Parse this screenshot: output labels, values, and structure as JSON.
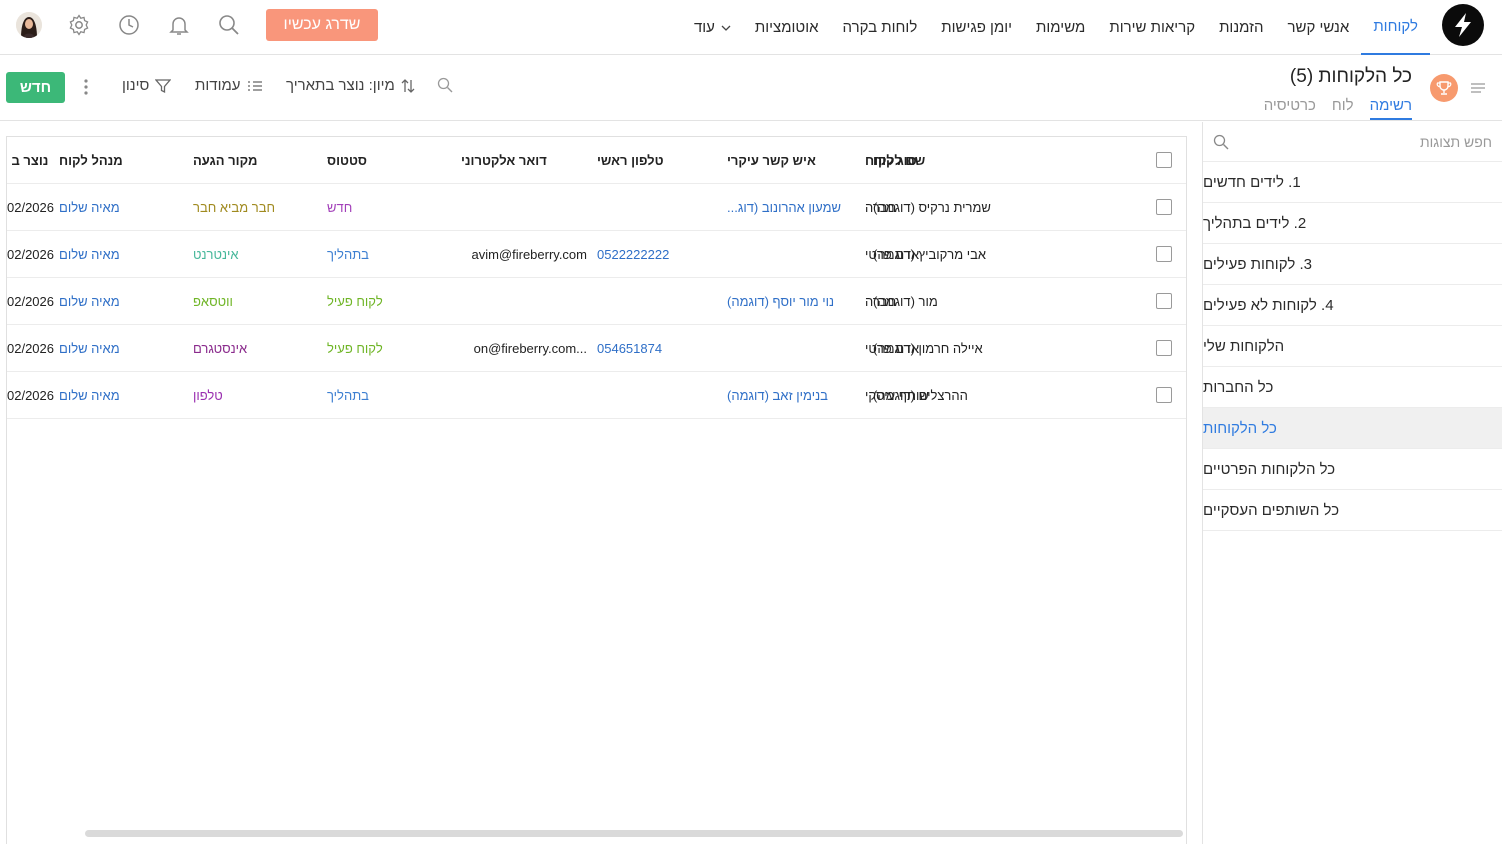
{
  "nav": {
    "items": [
      "לקוחות",
      "אנשי קשר",
      "הזמנות",
      "קריאות שירות",
      "משימות",
      "יומן פגישות",
      "לוחות בקרה",
      "אוטומציות"
    ],
    "more_label": "עוד",
    "upgrade_label": "שדרג עכשיו",
    "icons": [
      "search-icon",
      "bell-icon",
      "clock-icon",
      "gear-icon"
    ],
    "accent_color": "#2f7be0",
    "upgrade_color": "#f9967b"
  },
  "header": {
    "title": "כל הלקוחות (5)",
    "view_tabs": [
      "רשימה",
      "לוח",
      "כרטיסיה"
    ],
    "sort_label": "מיון: נוצר בתאריך",
    "columns_label": "עמודות",
    "filter_label": "סינון",
    "new_label": "חדש",
    "new_color": "#3cb878"
  },
  "sidebar": {
    "search_placeholder": "חפש תצוגות",
    "items": [
      "1. לידים חדשים",
      "2. לידים בתהליך",
      "3. לקוחות פעילים",
      "4. לקוחות לא פעילים",
      "הלקוחות שלי",
      "כל החברות",
      "כל הלקוחות",
      "כל הלקוחות הפרטיים",
      "כל השותפים העסקיים"
    ],
    "active_index": 6
  },
  "table": {
    "columns": [
      "שם לקוח",
      "סוג לקוח",
      "איש קשר עיקרי",
      "טלפון ראשי",
      "דואר אלקטרוני",
      "סטטוס",
      "מקור הגעה",
      "מנהל לקוח",
      "נוצר ב"
    ],
    "sorted_column_arrow": "↓",
    "rows": [
      {
        "name": "שמרית נרקיס (דוגמה)",
        "type": "חברה",
        "contact": "שמעון אהרונוב (דוג...",
        "phone": "",
        "email": "",
        "status": "חדש",
        "status_color": "#a23fb9",
        "source": "חבר מביא חבר",
        "source_color": "#a08a1f",
        "manager": "מאיה שלום",
        "created": "02/2026"
      },
      {
        "name": "אבי מרקוביץ (דוגמה)",
        "type": "אדם פרטי",
        "contact": "",
        "phone": "0522222222",
        "email": "avim@fireberry.com",
        "status": "בתהליך",
        "status_color": "#3d7fd1",
        "source": "אינטרנט",
        "source_color": "#46b79a",
        "manager": "מאיה שלום",
        "created": "02/2026"
      },
      {
        "name": "מור (דוגמה)",
        "type": "חברה",
        "contact": "נוי מור יוסף (דוגמה)",
        "phone": "",
        "email": "",
        "status": "לקוח פעיל",
        "status_color": "#6fb526",
        "source": "ווטסאפ",
        "source_color": "#6fb526",
        "manager": "מאיה שלום",
        "created": "02/2026"
      },
      {
        "name": "איילה חרמון (דוגמה)",
        "type": "אדם פרטי",
        "contact": "",
        "phone": "054651874",
        "email": "on@fireberry.com...",
        "status": "לקוח פעיל",
        "status_color": "#6fb526",
        "source": "אינסטגרם",
        "source_color": "#8a2a8c",
        "manager": "מאיה שלום",
        "created": "02/2026"
      },
      {
        "name": "ההרצלים (דוגמה)",
        "type": "שותף עיסקי",
        "contact": "בנימין זאב (דוגמה)",
        "phone": "",
        "email": "",
        "status": "בתהליך",
        "status_color": "#3d7fd1",
        "source": "טלפון",
        "source_color": "#9a2fb0",
        "manager": "מאיה שלום",
        "created": "02/2026"
      }
    ]
  }
}
